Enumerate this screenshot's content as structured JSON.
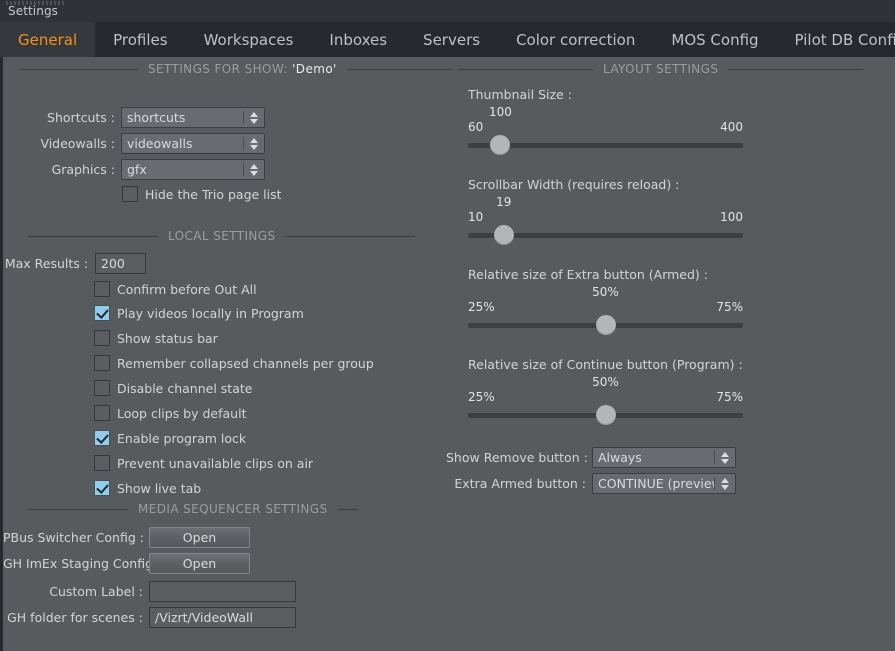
{
  "window": {
    "title": "Settings"
  },
  "tabs": [
    {
      "label": "General",
      "active": true
    },
    {
      "label": "Profiles",
      "active": false
    },
    {
      "label": "Workspaces",
      "active": false
    },
    {
      "label": "Inboxes",
      "active": false
    },
    {
      "label": "Servers",
      "active": false
    },
    {
      "label": "Color correction",
      "active": false
    },
    {
      "label": "MOS Config",
      "active": false
    },
    {
      "label": "Pilot DB Config",
      "active": false
    }
  ],
  "sections": {
    "show_settings": {
      "heading_prefix": "SETTINGS FOR SHOW: ",
      "heading_value": "'Demo'"
    },
    "local_settings": {
      "heading": "LOCAL SETTINGS"
    },
    "media_sequencer": {
      "heading": "MEDIA SEQUENCER SETTINGS"
    },
    "layout_settings": {
      "heading": "LAYOUT SETTINGS"
    }
  },
  "show_settings": {
    "shortcuts": {
      "label": "Shortcuts :",
      "value": "shortcuts"
    },
    "videowalls": {
      "label": "Videowalls :",
      "value": "videowalls"
    },
    "graphics": {
      "label": "Graphics :",
      "value": "gfx"
    },
    "hide_trio": {
      "label": "Hide the Trio page list",
      "checked": false
    }
  },
  "local_settings": {
    "max_results": {
      "label": "Max Results :",
      "value": "200"
    },
    "checkboxes": [
      {
        "label": "Confirm before Out All",
        "checked": false
      },
      {
        "label": "Play videos locally in Program",
        "checked": true
      },
      {
        "label": "Show status bar",
        "checked": false
      },
      {
        "label": "Remember collapsed channels per group",
        "checked": false
      },
      {
        "label": "Disable channel state",
        "checked": false
      },
      {
        "label": "Loop clips by default",
        "checked": false
      },
      {
        "label": "Enable program lock",
        "checked": true
      },
      {
        "label": "Prevent unavailable clips on air",
        "checked": false
      },
      {
        "label": "Show live tab",
        "checked": true
      }
    ]
  },
  "media_sequencer": {
    "pbus": {
      "label": "PBus Switcher Config :",
      "button": "Open"
    },
    "ghimex": {
      "label": "GH ImEx Staging Config :",
      "button": "Open"
    },
    "custom_label": {
      "label": "Custom Label :",
      "value": "",
      "placeholder": ""
    },
    "gh_folder": {
      "label": "GH folder for scenes :",
      "value": "/Vizrt/VideoWall"
    }
  },
  "layout_settings": {
    "sliders": [
      {
        "title": "Thumbnail Size :",
        "value": "100",
        "min_label": "60",
        "max_label": "400",
        "min": 60,
        "max": 400,
        "current": 100
      },
      {
        "title": "Scrollbar Width (requires reload) :",
        "value": "19",
        "min_label": "10",
        "max_label": "100",
        "min": 10,
        "max": 100,
        "current": 19
      },
      {
        "title": "Relative size of Extra button (Armed) :",
        "value": "50%",
        "min_label": "25%",
        "max_label": "75%",
        "min": 25,
        "max": 75,
        "current": 50
      },
      {
        "title": "Relative size of Continue button (Program) :",
        "value": "50%",
        "min_label": "25%",
        "max_label": "75%",
        "min": 25,
        "max": 75,
        "current": 50
      }
    ],
    "show_remove_button": {
      "label": "Show Remove button :",
      "value": "Always"
    },
    "extra_armed_button": {
      "label": "Extra Armed button :",
      "value": "CONTINUE (preview ..."
    }
  },
  "colors": {
    "accent": "#f39316",
    "content_bg": "#575b5e",
    "chrome_bg": "#2b2e33",
    "tabbar_bg": "#26292e",
    "active_tab_bg": "#35383d",
    "checkbox_checked": "#8ecdec"
  }
}
